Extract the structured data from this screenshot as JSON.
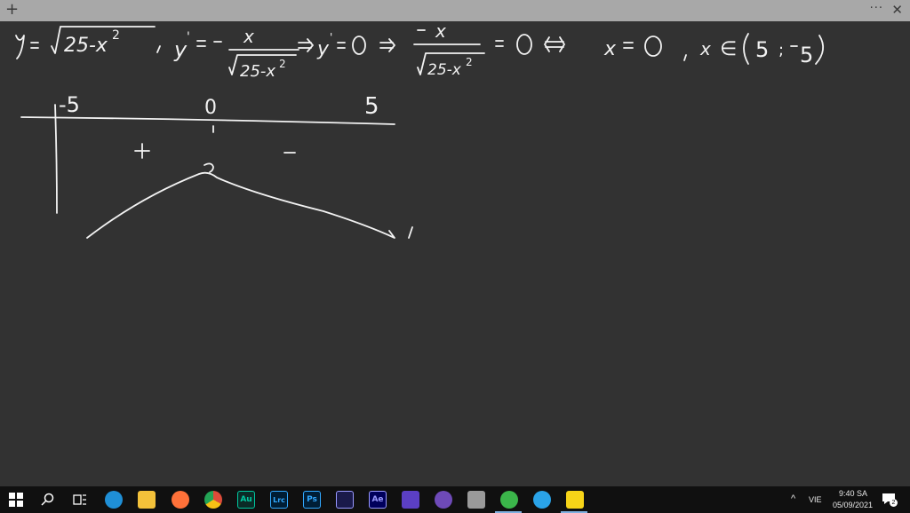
{
  "titlebar": {
    "new_label": "+",
    "more_label": "···",
    "close_label": "✕"
  },
  "board": {
    "eq_y": "y = √25-x²",
    "eq_yprime": "y' = − x / √25-x²",
    "eq_zero": "⇒ y' = 0 ⇒ −x / √25-x² = 0",
    "eq_root": "⇔ x = 0",
    "eq_domain": "x ∈ (5 ; -5)",
    "row_labels": [
      "-5",
      "0",
      "5"
    ],
    "signs": [
      "+",
      "−"
    ],
    "peak_mark": "?"
  },
  "taskbar": {
    "apps": [
      {
        "name": "start-icon",
        "label": ""
      },
      {
        "name": "search-icon",
        "label": ""
      },
      {
        "name": "task-view-icon",
        "label": ""
      },
      {
        "name": "edge-icon",
        "label": ""
      },
      {
        "name": "file-explorer-icon",
        "label": ""
      },
      {
        "name": "firefox-icon",
        "label": ""
      },
      {
        "name": "chrome-icon",
        "label": ""
      },
      {
        "name": "audition-icon",
        "label": "Au"
      },
      {
        "name": "lightroom-icon",
        "label": "Lrc"
      },
      {
        "name": "photoshop-icon",
        "label": "Ps"
      },
      {
        "name": "app-icon",
        "label": ""
      },
      {
        "name": "after-effects-icon",
        "label": "Ae"
      },
      {
        "name": "app-icon-2",
        "label": ""
      },
      {
        "name": "github-icon",
        "label": ""
      },
      {
        "name": "app-icon-3",
        "label": ""
      },
      {
        "name": "app-icon-4",
        "label": ""
      },
      {
        "name": "app-icon-5",
        "label": ""
      },
      {
        "name": "sticky-notes-icon",
        "label": ""
      }
    ],
    "language": "VIE",
    "time": "9:40 SA",
    "date": "05/09/2021",
    "notifications": "2",
    "colors": {
      "edge": "#1f8fd6",
      "explorer": "#f3c13a",
      "firefox": "#ff7139",
      "chrome": "#dd4b39",
      "audition": "#00c8a0",
      "lightroom": "#31a8ff",
      "photoshop": "#31a8ff",
      "after_effects": "#9999ff",
      "sticky": "#f7d418"
    }
  }
}
